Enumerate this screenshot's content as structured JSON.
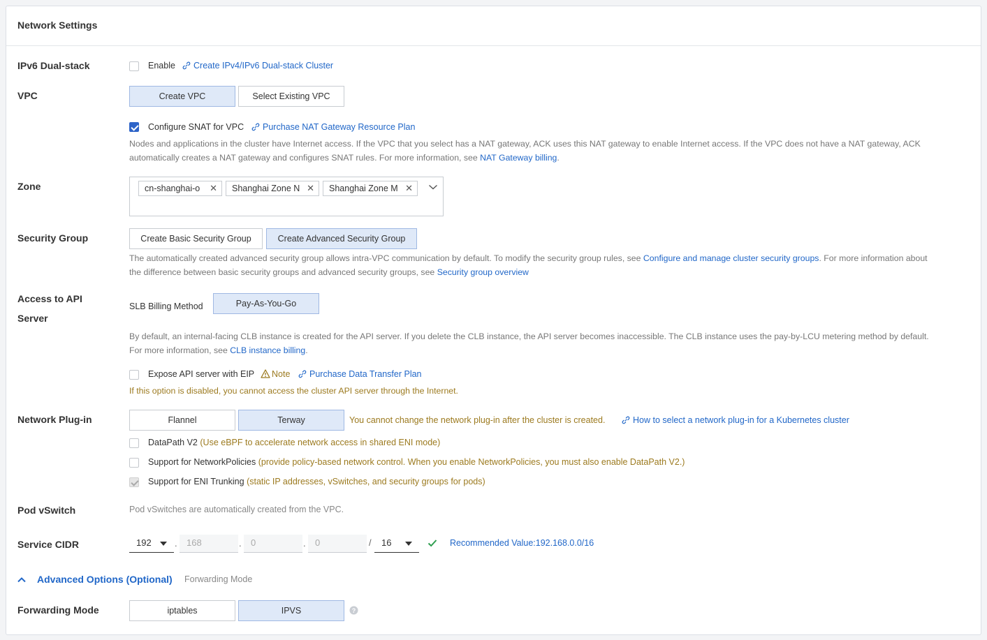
{
  "panel": {
    "title": "Network Settings"
  },
  "ipv6": {
    "label": "IPv6 Dual-stack",
    "enable_label": "Enable",
    "link": "Create IPv4/IPv6 Dual-stack Cluster"
  },
  "vpc": {
    "label": "VPC",
    "create_btn": "Create VPC",
    "select_btn": "Select Existing VPC",
    "snat_label": "Configure SNAT for VPC",
    "snat_link": "Purchase NAT Gateway Resource Plan",
    "desc_line1": "Nodes and applications in the cluster have Internet access. If the VPC that you select has a NAT gateway, ACK uses this NAT gateway to enable Internet access. If the VPC does not have a NAT gateway, ACK",
    "desc_line2": "automatically creates a NAT gateway and configures SNAT rules. For more information, see",
    "desc_link": "NAT Gateway billing",
    "desc_end": "."
  },
  "zone": {
    "label": "Zone",
    "tags": [
      "cn-shanghai-o",
      "Shanghai Zone N",
      "Shanghai Zone M"
    ]
  },
  "security_group": {
    "label": "Security Group",
    "basic_btn": "Create Basic Security Group",
    "advanced_btn": "Create Advanced Security Group",
    "note_part1": "The automatically created advanced security group allows intra-VPC communication by default. To modify the security group rules, see",
    "note_link1": "Configure and manage cluster security groups",
    "note_part2": ". For more information about",
    "note_part3": "the difference between basic security groups and advanced security groups, see",
    "note_link2": "Security group overview"
  },
  "api_server": {
    "label_line1": "Access to API",
    "label_line2": "Server",
    "slb_label": "SLB Billing Method",
    "slb_btn": "Pay-As-You-Go",
    "desc_line1": "By default, an internal-facing CLB instance is created for the API server. If you delete the CLB instance, the API server becomes inaccessible. The CLB instance uses the pay-by-LCU metering method by default.",
    "desc_line2": "For more information, see",
    "desc_link": "CLB instance billing",
    "desc_end": ".",
    "eip_label": "Expose API server with EIP",
    "note_label": "Note",
    "eip_link": "Purchase Data Transfer Plan",
    "eip_warn": "If this option is disabled, you cannot access the cluster API server through the Internet."
  },
  "network_plugin": {
    "label": "Network Plug-in",
    "flannel_btn": "Flannel",
    "terway_btn": "Terway",
    "warn": "You cannot change the network plug-in after the cluster is created.",
    "link": "How to select a network plug-in for a Kubernetes cluster",
    "datapath_label": "DataPath V2",
    "datapath_note": "(Use eBPF to accelerate network access in shared ENI mode)",
    "netpol_label": "Support for NetworkPolicies",
    "netpol_note": "(provide policy-based network control. When you enable NetworkPolicies, you must also enable DataPath V2.)",
    "eni_label": "Support for ENI Trunking",
    "eni_note": "(static IP addresses, vSwitches, and security groups for pods)"
  },
  "pod_vswitch": {
    "label": "Pod vSwitch",
    "text": "Pod vSwitches are automatically created from the VPC."
  },
  "service_cidr": {
    "label": "Service CIDR",
    "octet1": "192",
    "octet2": "168",
    "octet3": "0",
    "octet4": "0",
    "dot": ".",
    "slash": "/",
    "mask": "16",
    "recommended": "Recommended Value:192.168.0.0/16"
  },
  "advanced": {
    "toggle_label": "Advanced Options (Optional)",
    "hint": "Forwarding Mode"
  },
  "forwarding": {
    "label": "Forwarding Mode",
    "iptables_btn": "iptables",
    "ipvs_btn": "IPVS"
  },
  "colors": {
    "link": "#2167c8",
    "warn": "#9c7a1f",
    "selected_bg": "#dfe9f8",
    "check": "#2e64c8",
    "success": "#2e9e4f"
  }
}
